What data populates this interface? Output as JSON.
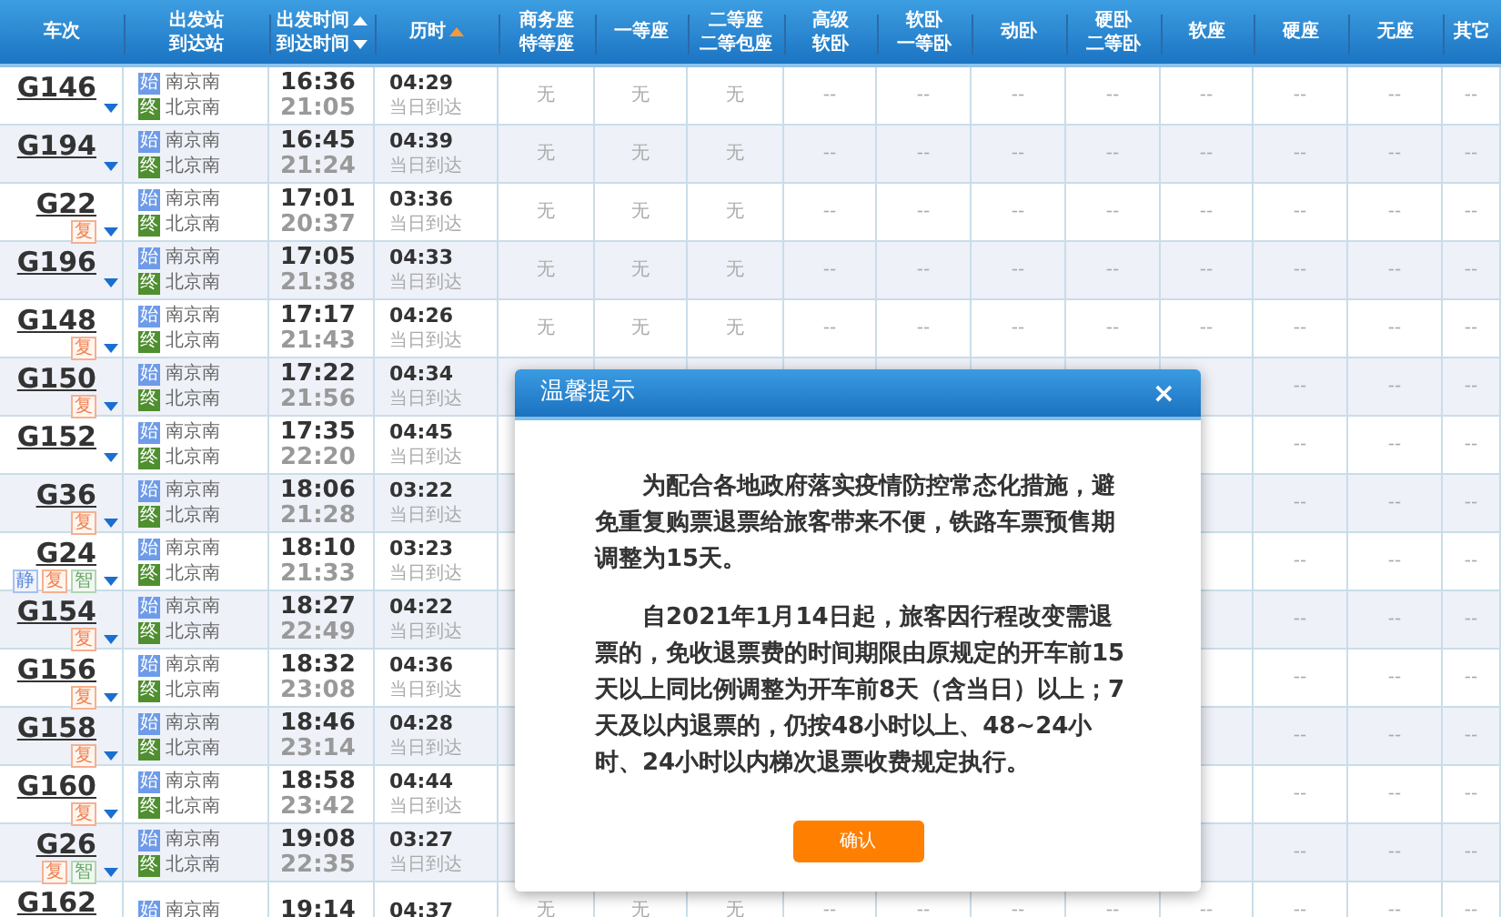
{
  "columns": [
    {
      "lines": [
        "车次"
      ]
    },
    {
      "lines": [
        "出发站",
        "到达站"
      ]
    },
    {
      "lines": [
        "出发时间",
        "到达时间"
      ],
      "sort_arrows": true
    },
    {
      "lines": [
        "历时"
      ],
      "sorted": true
    },
    {
      "lines": [
        "商务座",
        "特等座"
      ]
    },
    {
      "lines": [
        "一等座"
      ]
    },
    {
      "lines": [
        "二等座",
        "二等包座"
      ]
    },
    {
      "lines": [
        "高级",
        "软卧"
      ]
    },
    {
      "lines": [
        "软卧",
        "一等卧"
      ]
    },
    {
      "lines": [
        "动卧"
      ]
    },
    {
      "lines": [
        "硬卧",
        "二等卧"
      ]
    },
    {
      "lines": [
        "软座"
      ]
    },
    {
      "lines": [
        "硬座"
      ]
    },
    {
      "lines": [
        "无座"
      ]
    },
    {
      "lines": [
        "其它"
      ]
    }
  ],
  "rows": [
    {
      "train": "G146",
      "badges": [],
      "from_tag": "始",
      "from": "南京南",
      "to_tag": "终",
      "to": "北京南",
      "depart": "16:36",
      "arrive": "21:05",
      "duration": "04:29",
      "arrival_day": "当日到达",
      "seats": [
        "无",
        "无",
        "无",
        "--",
        "--",
        "--",
        "--",
        "--",
        "--",
        "--",
        "--"
      ]
    },
    {
      "train": "G194",
      "badges": [],
      "from_tag": "始",
      "from": "南京南",
      "to_tag": "终",
      "to": "北京南",
      "depart": "16:45",
      "arrive": "21:24",
      "duration": "04:39",
      "arrival_day": "当日到达",
      "seats": [
        "无",
        "无",
        "无",
        "--",
        "--",
        "--",
        "--",
        "--",
        "--",
        "--",
        "--"
      ]
    },
    {
      "train": "G22",
      "badges": [
        {
          "kind": "fu",
          "text": "复"
        }
      ],
      "from_tag": "始",
      "from": "南京南",
      "to_tag": "终",
      "to": "北京南",
      "depart": "17:01",
      "arrive": "20:37",
      "duration": "03:36",
      "arrival_day": "当日到达",
      "seats": [
        "无",
        "无",
        "无",
        "--",
        "--",
        "--",
        "--",
        "--",
        "--",
        "--",
        "--"
      ]
    },
    {
      "train": "G196",
      "badges": [],
      "from_tag": "始",
      "from": "南京南",
      "to_tag": "终",
      "to": "北京南",
      "depart": "17:05",
      "arrive": "21:38",
      "duration": "04:33",
      "arrival_day": "当日到达",
      "seats": [
        "无",
        "无",
        "无",
        "--",
        "--",
        "--",
        "--",
        "--",
        "--",
        "--",
        "--"
      ]
    },
    {
      "train": "G148",
      "badges": [
        {
          "kind": "fu",
          "text": "复"
        }
      ],
      "from_tag": "始",
      "from": "南京南",
      "to_tag": "终",
      "to": "北京南",
      "depart": "17:17",
      "arrive": "21:43",
      "duration": "04:26",
      "arrival_day": "当日到达",
      "seats": [
        "无",
        "无",
        "无",
        "--",
        "--",
        "--",
        "--",
        "--",
        "--",
        "--",
        "--"
      ]
    },
    {
      "train": "G150",
      "badges": [
        {
          "kind": "fu",
          "text": "复"
        }
      ],
      "from_tag": "始",
      "from": "南京南",
      "to_tag": "终",
      "to": "北京南",
      "depart": "17:22",
      "arrive": "21:56",
      "duration": "04:34",
      "arrival_day": "当日到达",
      "seats": [
        "--",
        "--",
        "--"
      ]
    },
    {
      "train": "G152",
      "badges": [],
      "from_tag": "始",
      "from": "南京南",
      "to_tag": "终",
      "to": "北京南",
      "depart": "17:35",
      "arrive": "22:20",
      "duration": "04:45",
      "arrival_day": "当日到达",
      "seats": [
        "--",
        "--",
        "--"
      ]
    },
    {
      "train": "G36",
      "badges": [
        {
          "kind": "fu",
          "text": "复"
        }
      ],
      "from_tag": "始",
      "from": "南京南",
      "to_tag": "终",
      "to": "北京南",
      "depart": "18:06",
      "arrive": "21:28",
      "duration": "03:22",
      "arrival_day": "当日到达",
      "seats": [
        "--",
        "--",
        "--"
      ]
    },
    {
      "train": "G24",
      "badges": [
        {
          "kind": "jing",
          "text": "静"
        },
        {
          "kind": "fu",
          "text": "复"
        },
        {
          "kind": "zhi",
          "text": "智"
        }
      ],
      "from_tag": "始",
      "from": "南京南",
      "to_tag": "终",
      "to": "北京南",
      "depart": "18:10",
      "arrive": "21:33",
      "duration": "03:23",
      "arrival_day": "当日到达",
      "seats": [
        "--",
        "--",
        "--"
      ]
    },
    {
      "train": "G154",
      "badges": [
        {
          "kind": "fu",
          "text": "复"
        }
      ],
      "from_tag": "始",
      "from": "南京南",
      "to_tag": "终",
      "to": "北京南",
      "depart": "18:27",
      "arrive": "22:49",
      "duration": "04:22",
      "arrival_day": "当日到达",
      "seats": [
        "--",
        "--",
        "--"
      ]
    },
    {
      "train": "G156",
      "badges": [
        {
          "kind": "fu",
          "text": "复"
        }
      ],
      "from_tag": "始",
      "from": "南京南",
      "to_tag": "终",
      "to": "北京南",
      "depart": "18:32",
      "arrive": "23:08",
      "duration": "04:36",
      "arrival_day": "当日到达",
      "seats": [
        "--",
        "--",
        "--"
      ]
    },
    {
      "train": "G158",
      "badges": [
        {
          "kind": "fu",
          "text": "复"
        }
      ],
      "from_tag": "始",
      "from": "南京南",
      "to_tag": "终",
      "to": "北京南",
      "depart": "18:46",
      "arrive": "23:14",
      "duration": "04:28",
      "arrival_day": "当日到达",
      "seats": [
        "--",
        "--",
        "--"
      ]
    },
    {
      "train": "G160",
      "badges": [
        {
          "kind": "fu",
          "text": "复"
        }
      ],
      "from_tag": "始",
      "from": "南京南",
      "to_tag": "终",
      "to": "北京南",
      "depart": "18:58",
      "arrive": "23:42",
      "duration": "04:44",
      "arrival_day": "当日到达",
      "seats": [
        "--",
        "--",
        "--"
      ]
    },
    {
      "train": "G26",
      "badges": [
        {
          "kind": "fu",
          "text": "复"
        },
        {
          "kind": "zhi",
          "text": "智"
        }
      ],
      "from_tag": "始",
      "from": "南京南",
      "to_tag": "终",
      "to": "北京南",
      "depart": "19:08",
      "arrive": "22:35",
      "duration": "03:27",
      "arrival_day": "当日到达",
      "seats": [
        "--",
        "--",
        "--"
      ]
    },
    {
      "train": "G162",
      "badges": [],
      "from_tag": "始",
      "from": "南京南",
      "depart": "19:14",
      "duration": "04:37",
      "seats": [
        "无",
        "无",
        "无",
        "--",
        "--",
        "--",
        "--",
        "--",
        "--",
        "--",
        "--"
      ]
    }
  ],
  "dialog": {
    "title": "温馨提示",
    "close": "×",
    "paragraphs": [
      "为配合各地政府落实疫情防控常态化措施，避免重复购票退票给旅客带来不便，铁路车票预售期调整为15天。",
      "自2021年1月14日起，旅客因行程改变需退票的，免收退票费的时间期限由原规定的开车前15天以上同比例调整为开车前8天（含当日）以上；7天及以内退票的，仍按48小时以上、48~24小时、24小时以内梯次退票收费规定执行。"
    ],
    "button": "确认"
  }
}
